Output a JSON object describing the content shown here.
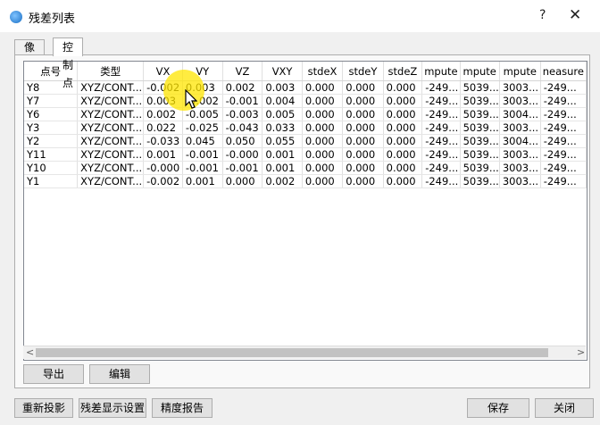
{
  "window": {
    "title": "残差列表",
    "help_label": "?",
    "close_label": "✕"
  },
  "tabs": [
    {
      "label": "像点"
    },
    {
      "label": "控制点"
    }
  ],
  "table": {
    "columns": [
      "点号",
      "类型",
      "VX",
      "VY",
      "VZ",
      "VXY",
      "stdeX",
      "stdeY",
      "stdeZ",
      "mpute",
      "mpute",
      "mpute",
      "neasure"
    ],
    "rows": [
      [
        "Y8",
        "XYZ/CONT...",
        "-0.002",
        "0.003",
        "0.002",
        "0.003",
        "0.000",
        "0.000",
        "0.000",
        "-249...",
        "5039...",
        "3003...",
        "-249..."
      ],
      [
        "Y7",
        "XYZ/CONT...",
        "0.003",
        "-0.002",
        "-0.001",
        "0.004",
        "0.000",
        "0.000",
        "0.000",
        "-249...",
        "5039...",
        "3003...",
        "-249..."
      ],
      [
        "Y6",
        "XYZ/CONT...",
        "0.002",
        "-0.005",
        "-0.003",
        "0.005",
        "0.000",
        "0.000",
        "0.000",
        "-249...",
        "5039...",
        "3004...",
        "-249..."
      ],
      [
        "Y3",
        "XYZ/CONT...",
        "0.022",
        "-0.025",
        "-0.043",
        "0.033",
        "0.000",
        "0.000",
        "0.000",
        "-249...",
        "5039...",
        "3003...",
        "-249..."
      ],
      [
        "Y2",
        "XYZ/CONT...",
        "-0.033",
        "0.045",
        "0.050",
        "0.055",
        "0.000",
        "0.000",
        "0.000",
        "-249...",
        "5039...",
        "3004...",
        "-249..."
      ],
      [
        "Y11",
        "XYZ/CONT...",
        "0.001",
        "-0.001",
        "-0.000",
        "0.001",
        "0.000",
        "0.000",
        "0.000",
        "-249...",
        "5039...",
        "3003...",
        "-249..."
      ],
      [
        "Y10",
        "XYZ/CONT...",
        "-0.000",
        "-0.001",
        "-0.001",
        "0.001",
        "0.000",
        "0.000",
        "0.000",
        "-249...",
        "5039...",
        "3003...",
        "-249..."
      ],
      [
        "Y1",
        "XYZ/CONT...",
        "-0.002",
        "0.001",
        "0.000",
        "0.002",
        "0.000",
        "0.000",
        "0.000",
        "-249...",
        "5039...",
        "3003...",
        "-249..."
      ]
    ]
  },
  "scroll": {
    "left_arrow": "<",
    "right_arrow": ">"
  },
  "buttons": {
    "export": "导出",
    "edit": "编辑",
    "reproject": "重新投影",
    "residual_settings": "残差显示设置",
    "precision_report": "精度报告",
    "save": "保存",
    "close": "关闭"
  }
}
